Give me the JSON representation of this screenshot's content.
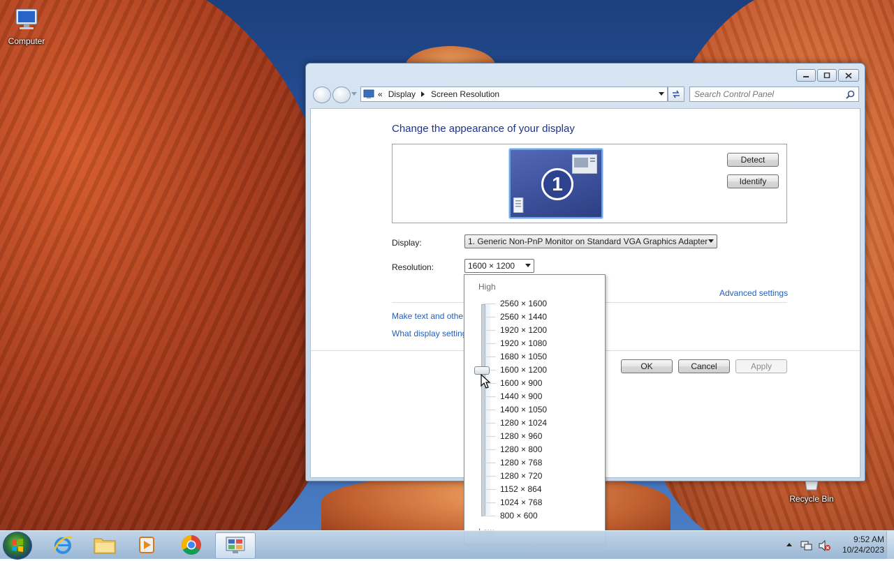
{
  "desktop": {
    "icons": [
      {
        "label": "Computer"
      },
      {
        "label": "Recycle Bin"
      }
    ]
  },
  "window": {
    "breadcrumb": {
      "root_chevron": "«",
      "items": [
        "Display",
        "Screen Resolution"
      ]
    },
    "search": {
      "placeholder": "Search Control Panel"
    },
    "page_title": "Change the appearance of your display",
    "monitor_number": "1",
    "detect_label": "Detect",
    "identify_label": "Identify",
    "display": {
      "label": "Display:",
      "value": "1. Generic Non-PnP Monitor on Standard VGA Graphics Adapter"
    },
    "resolution": {
      "label": "Resolution:",
      "value": "1600 × 1200"
    },
    "advanced_settings": "Advanced settings",
    "links": [
      "Make text and other",
      "What display setting"
    ],
    "buttons": {
      "ok": "OK",
      "cancel": "Cancel",
      "apply": "Apply"
    }
  },
  "resolution_dropdown": {
    "high_label": "High",
    "low_label": "Low",
    "options": [
      "2560 × 1600",
      "2560 × 1440",
      "1920 × 1200",
      "1920 × 1080",
      "1680 × 1050",
      "1600 × 1200",
      "1600 × 900",
      "1440 × 900",
      "1400 × 1050",
      "1280 × 1024",
      "1280 × 960",
      "1280 × 800",
      "1280 × 768",
      "1280 × 720",
      "1152 × 864",
      "1024 × 768",
      "800 × 600"
    ],
    "selected_index": 5
  },
  "taskbar": {
    "items": [
      "start-button",
      "internet-explorer-icon",
      "file-explorer-icon",
      "media-player-icon",
      "chrome-icon",
      "control-panel-icon"
    ],
    "clock": {
      "time": "9:52 AM",
      "date": "10/24/2023"
    }
  },
  "colors": {
    "title_text": "#1e3287",
    "link": "#1f5fbf",
    "monitor_fill": "#3a4f99"
  }
}
